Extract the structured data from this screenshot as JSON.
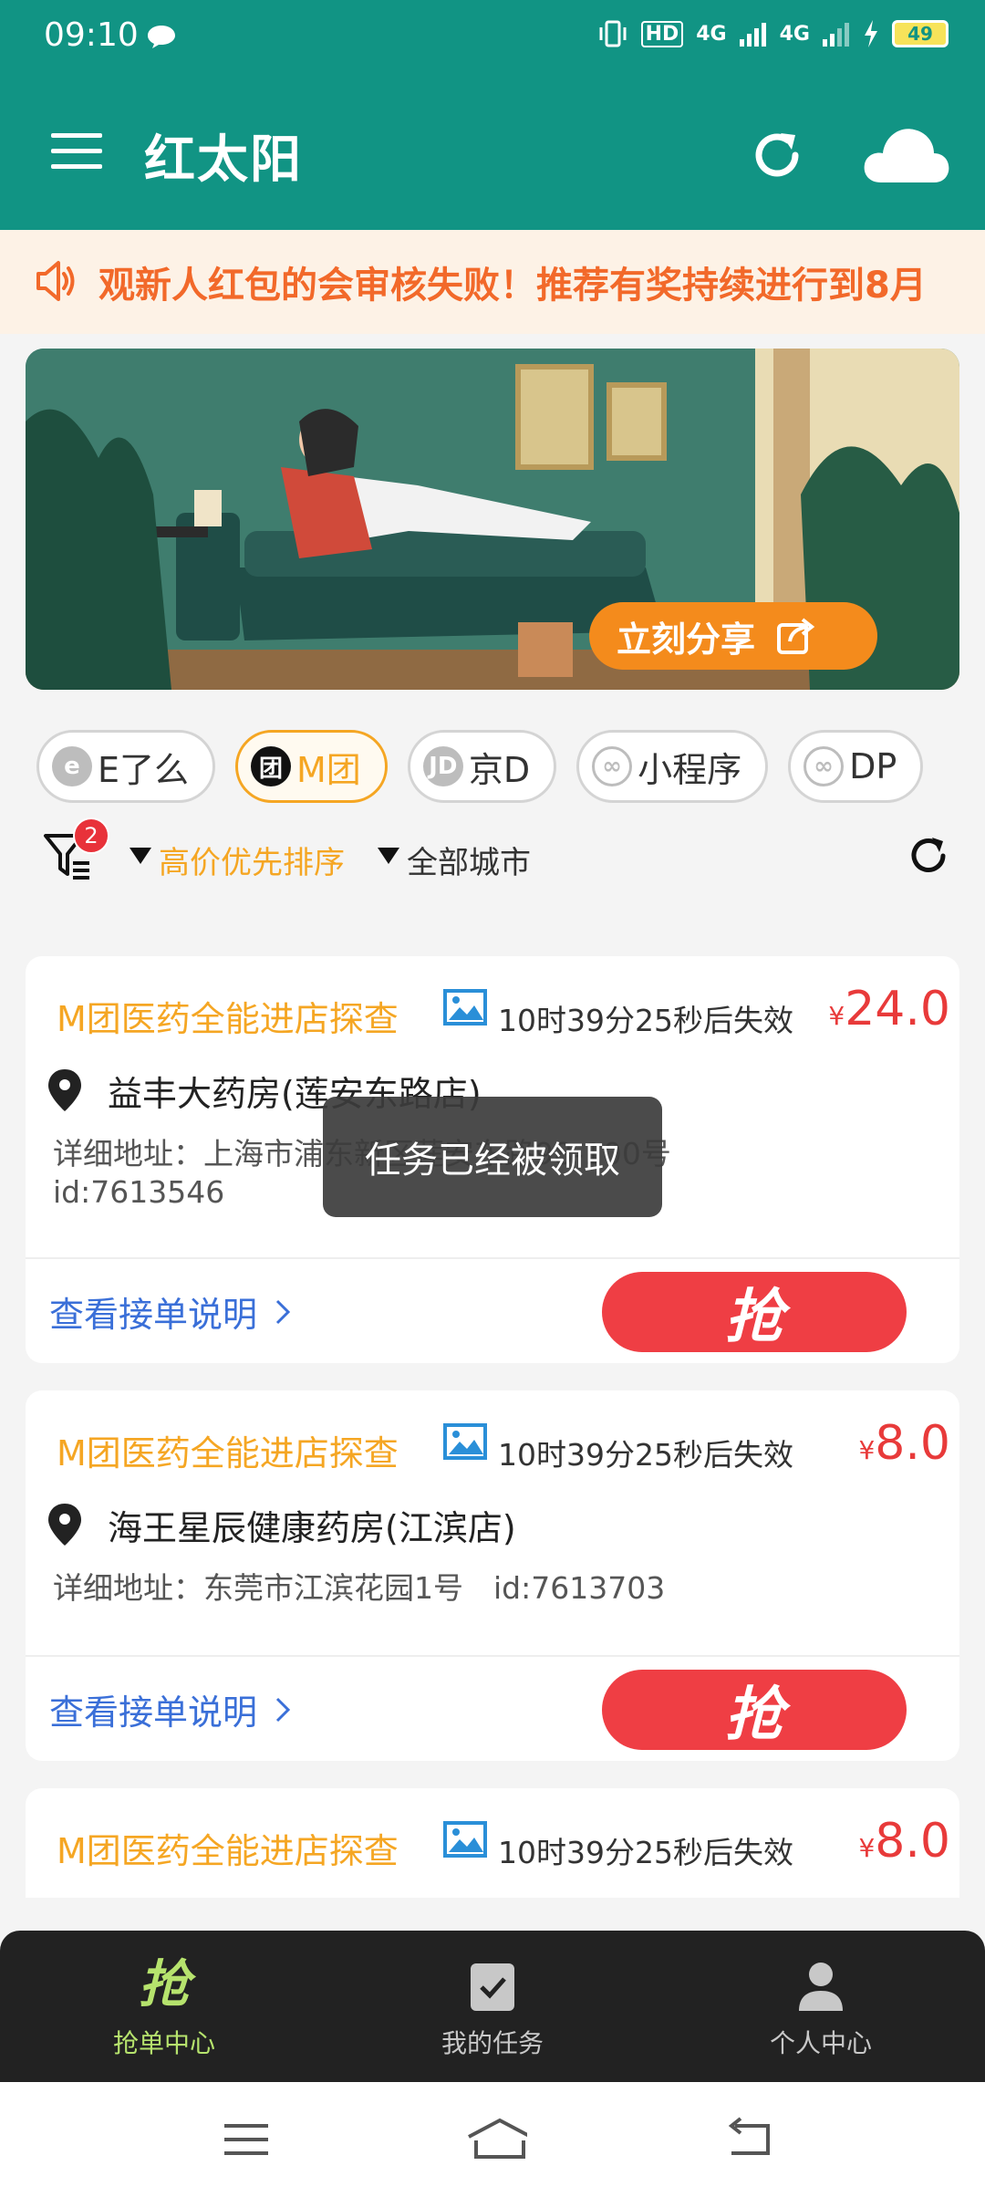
{
  "status_bar": {
    "time": "09:10",
    "battery": "49",
    "network_1": "4G",
    "network_2": "4G",
    "hd": "HD"
  },
  "app_bar": {
    "title": "红太阳"
  },
  "notice": {
    "text": "观新人红包的会审核失败！推荐有奖持续进行到8月"
  },
  "banner": {
    "share_label": "立刻分享"
  },
  "platform_chips": [
    {
      "icon_text": "e",
      "label": "E了么",
      "active": false
    },
    {
      "icon_text": "团",
      "label": "M团",
      "active": true
    },
    {
      "icon_text": "JD",
      "label": "京D",
      "active": false
    },
    {
      "icon_text": "∞",
      "label": "小程序",
      "active": false
    },
    {
      "icon_text": "∞",
      "label": "DP",
      "active": false
    }
  ],
  "filters": {
    "badge_count": "2",
    "sort_label": "高价优先排序",
    "city_label": "全部城市"
  },
  "tasks": [
    {
      "title": "M团医药全能进店探查",
      "countdown": "10时39分25秒后失效",
      "currency": "¥",
      "price": "24.0",
      "shop": "益丰大药房(莲安东路店)",
      "address_line1": "详细地址：上海市浦东新区莲安东路98-100号",
      "address_line2": "id:7613546",
      "guide_label": "查看接单说明",
      "grab_label": "抢"
    },
    {
      "title": "M团医药全能进店探查",
      "countdown": "10时39分25秒后失效",
      "currency": "¥",
      "price": "8.0",
      "shop": "海王星辰健康药房(江滨店)",
      "address_line1": "详细地址：东莞市江滨花园1号　id:7613703",
      "guide_label": "查看接单说明",
      "grab_label": "抢"
    },
    {
      "title": "M团医药全能进店探查",
      "countdown": "10时39分25秒后失效",
      "currency": "¥",
      "price": "8.0"
    }
  ],
  "toast": {
    "message": "任务已经被领取"
  },
  "tab_bar": {
    "items": [
      {
        "icon_text": "抢",
        "label": "抢单中心",
        "active": true
      },
      {
        "label": "我的任务",
        "active": false
      },
      {
        "label": "个人中心",
        "active": false
      }
    ]
  },
  "colors": {
    "primary": "#119484",
    "accent_orange": "#f5a623",
    "price_red": "#e83a3a",
    "grab_red": "#ef3e44",
    "link_blue": "#3a6fd8",
    "tab_active": "#b6e36d"
  }
}
